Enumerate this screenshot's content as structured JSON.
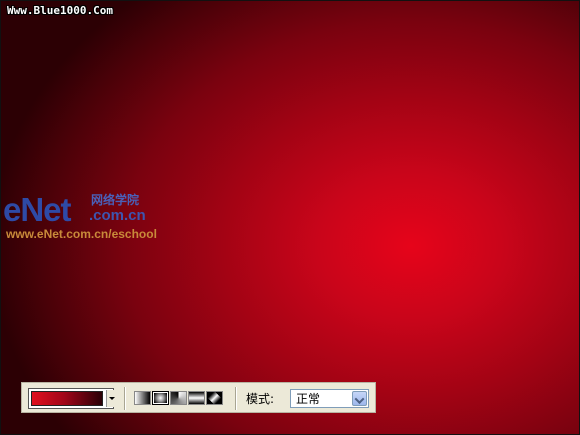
{
  "watermark": {
    "site": "Www.Blue1000.Com"
  },
  "logo": {
    "brand": "eNet",
    "brand_cn": "网络学院",
    "domain": ".com.cn",
    "url": "www.eNet.com.cn/eschool"
  },
  "toolbar": {
    "gradient": {
      "colors": [
        "#e0101f",
        "#a3061a",
        "#2a0006"
      ]
    },
    "gradient_types": [
      {
        "name": "linear-gradient",
        "selected": false
      },
      {
        "name": "radial-gradient",
        "selected": true
      },
      {
        "name": "angle-gradient",
        "selected": false
      },
      {
        "name": "reflected-gradient",
        "selected": false
      },
      {
        "name": "diamond-gradient",
        "selected": false
      }
    ],
    "mode_label": "模式:",
    "mode_value": "正常"
  },
  "canvas": {
    "center_color": "#e6041a",
    "edge_color": "#2c0004"
  }
}
